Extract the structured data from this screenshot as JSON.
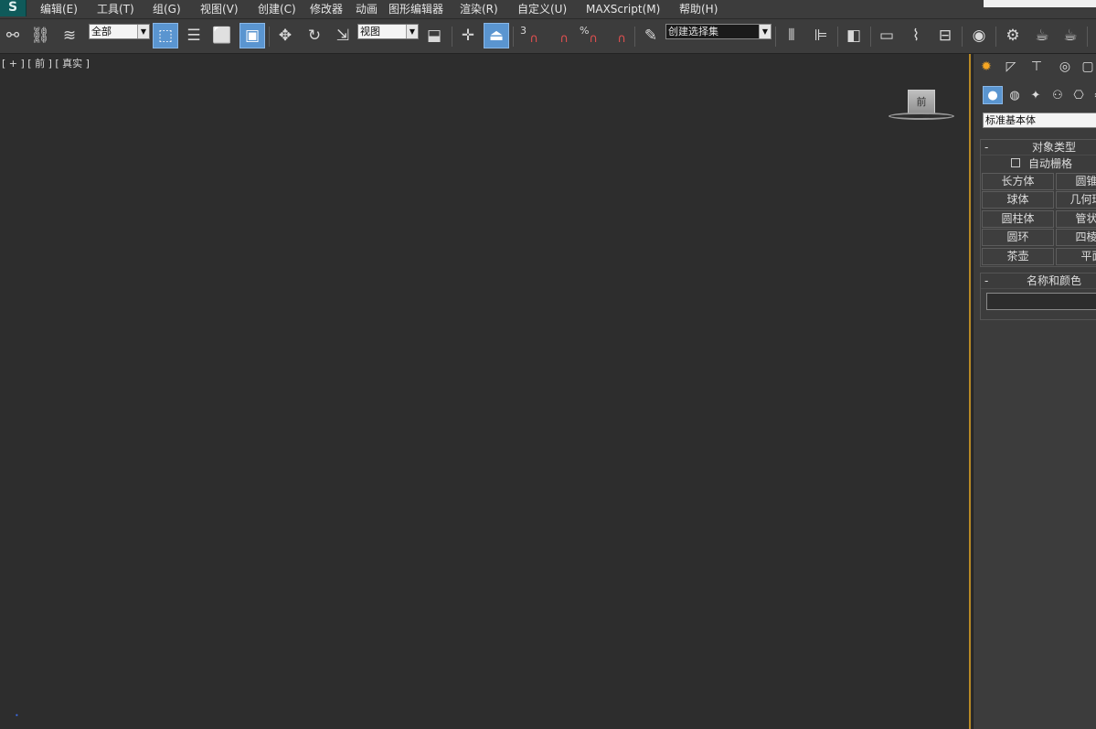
{
  "app": {
    "logo_letter": "S"
  },
  "menu": [
    "编辑(E)",
    "工具(T)",
    "组(G)",
    "视图(V)",
    "创建(C)",
    "修改器",
    "动画",
    "图形编辑器",
    "渲染(R)",
    "自定义(U)",
    "MAXScript(M)",
    "帮助(H)"
  ],
  "toolbar": {
    "selection_filter": "全部",
    "reference_coord": "视图",
    "named_selection_placeholder": "创建选择集",
    "snap_3d_label": "3",
    "percent_snap_label": "%"
  },
  "viewport": {
    "label": "[ + ] [ 前 ] [ 真实 ]",
    "viewcube_face": "前"
  },
  "command_panel": {
    "category": "标准基本体",
    "object_type": {
      "title": "对象类型",
      "autogrid_label": "自动栅格",
      "autogrid_checked": false,
      "buttons": [
        "长方体",
        "圆锥体",
        "球体",
        "几何球体",
        "圆柱体",
        "管状体",
        "圆环",
        "四棱锥",
        "茶壶",
        "平面"
      ]
    },
    "name_and_color": {
      "title": "名称和颜色",
      "name_value": ""
    }
  },
  "colors": {
    "active_blue": "#5a95d0",
    "viewport_border": "#b98a25",
    "create_tab_orange": "#f6a623"
  }
}
